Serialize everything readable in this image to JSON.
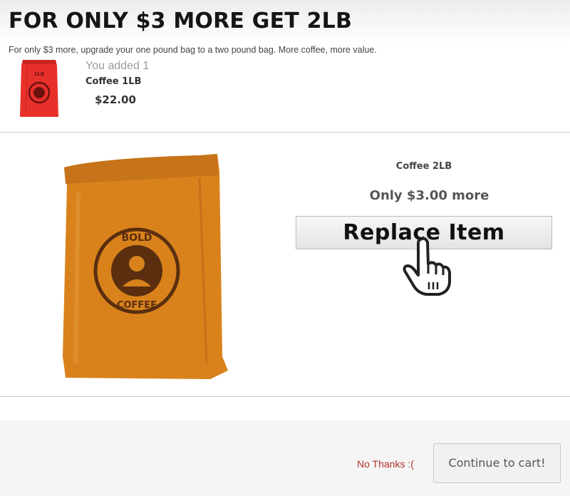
{
  "header": {
    "title": "FOR ONLY $3 MORE GET 2LB",
    "subtitle": "For only $3 more, upgrade your one pound bag to a two pound bag. More coffee, more value."
  },
  "added_item": {
    "label": "You added 1",
    "name": "Coffee 1LB",
    "price": "$22.00",
    "bag_text": "1LB",
    "bag_color": "#e8302a"
  },
  "offer": {
    "name": "Coffee 2LB",
    "price_text": "Only $3.00 more",
    "replace_label": "Replace Item",
    "bag_color": "#d9821c",
    "logo_top_text": "BOLD",
    "logo_bottom_text": "COFFEE"
  },
  "footer": {
    "no_thanks_label": "No Thanks :(",
    "continue_label": "Continue to cart!"
  },
  "icons": {
    "pointer": "hand-pointer-icon"
  }
}
